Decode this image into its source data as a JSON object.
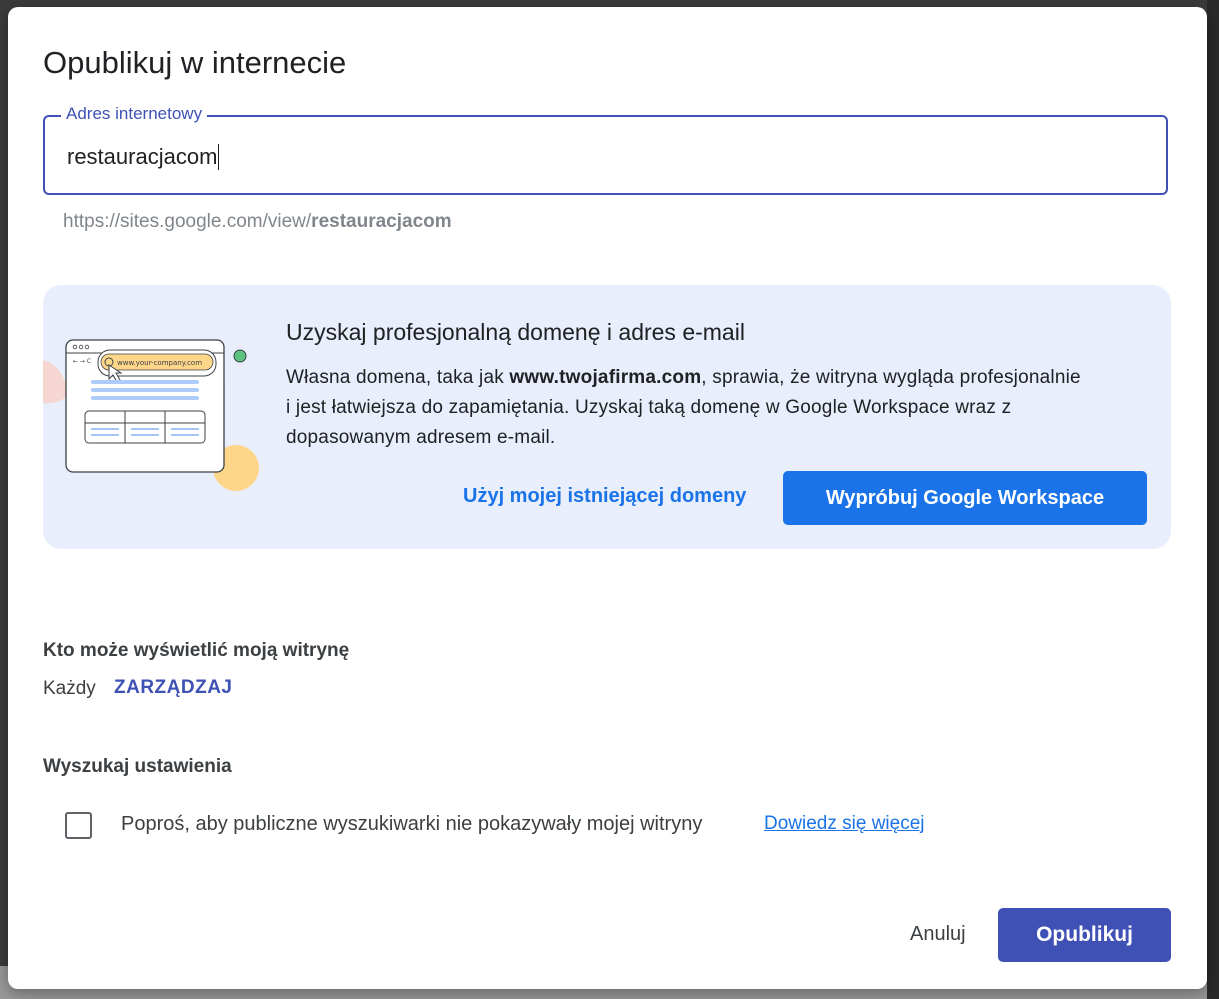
{
  "dialog": {
    "title": "Opublikuj w internecie",
    "address_field": {
      "label": "Adres internetowy",
      "value": "restauracjacom"
    },
    "url_preview": {
      "prefix": "https://sites.google.com/view/",
      "slug": "restauracjacom"
    },
    "promo": {
      "illustration_url_text": "www.your-company.com",
      "title": "Uzyskaj profesjonalną domenę i adres e-mail",
      "text_before": "Własna domena, taka jak ",
      "text_bold": "www.twojafirma.com",
      "text_after": ", sprawia, że witryna wygląda profesjonalnie i jest łatwiejsza do zapamiętania. Uzyskaj taką domenę w Google Workspace wraz z dopasowanym adresem e-mail.",
      "existing_domain_label": "Użyj mojej istniejącej domeny",
      "try_workspace_label": "Wypróbuj Google Workspace"
    },
    "visibility": {
      "heading": "Kto może wyświetlić moją witrynę",
      "value": "Każdy",
      "manage_label": "ZARZĄDZAJ"
    },
    "search": {
      "heading": "Wyszukaj ustawienia",
      "checkbox_label": "Poproś, aby publiczne wyszukiwarki nie pokazywały mojej witryny",
      "checked": false,
      "learn_more_label": "Dowiedz się więcej"
    },
    "actions": {
      "cancel_label": "Anuluj",
      "publish_label": "Opublikuj"
    },
    "colors": {
      "accent": "#3f51b5",
      "blue_link": "#1a73e8",
      "promo_bg": "#e8eefb"
    }
  }
}
